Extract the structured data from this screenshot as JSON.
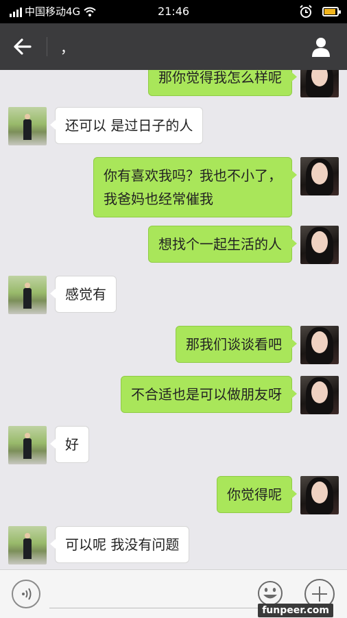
{
  "status_bar": {
    "carrier": "中国移动4G",
    "time": "21:46"
  },
  "header": {
    "title": "，"
  },
  "messages": [
    {
      "side": "right",
      "text": "那你觉得我怎么样呢"
    },
    {
      "side": "left",
      "text": "还可以 是过日子的人"
    },
    {
      "side": "right",
      "lines": [
        "你有喜欢我吗？我也不小了，",
        "我爸妈也经常催我"
      ]
    },
    {
      "side": "right",
      "text": "想找个一起生活的人"
    },
    {
      "side": "left",
      "text": "感觉有"
    },
    {
      "side": "right",
      "text": "那我们谈谈看吧"
    },
    {
      "side": "right",
      "text": "不合适也是可以做朋友呀"
    },
    {
      "side": "left",
      "text": "好"
    },
    {
      "side": "right",
      "text": "你觉得呢"
    },
    {
      "side": "left",
      "text": "可以呢 我没有问题"
    }
  ],
  "watermark": "funpeer.com",
  "colors": {
    "outgoing_bubble": "#a9e65a",
    "incoming_bubble": "#ffffff",
    "header": "#3b3b3d",
    "background": "#e9e8ec"
  }
}
